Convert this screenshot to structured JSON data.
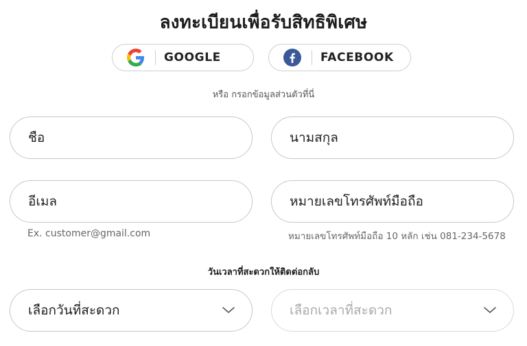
{
  "header": {
    "title": "ลงทะเบียนเพื่อรับสิทธิพิเศษ"
  },
  "social": {
    "google_label": "GOOGLE",
    "facebook_label": "FACEBOOK",
    "google_icon": "google-icon",
    "facebook_icon": "facebook-icon",
    "facebook_color": "#3b5998"
  },
  "divider_text": "หรือ กรอกข้อมูลส่วนตัวที่นี่",
  "form": {
    "first_name": {
      "placeholder": "ชื่อ",
      "value": ""
    },
    "last_name": {
      "placeholder": "นามสกุล",
      "value": ""
    },
    "email": {
      "placeholder": "อีเมล",
      "value": "",
      "hint": "Ex. customer@gmail.com"
    },
    "phone": {
      "placeholder": "หมายเลขโทรศัพท์มือถือ",
      "value": "",
      "hint": "หมายเลขโทรศัพท์มือถือ 10 หลัก เช่น 081-234-5678"
    }
  },
  "contact": {
    "label": "วันเวลาที่สะดวกให้ติดต่อกลับ",
    "date_select": {
      "value": "เลือกวันที่สะดวก",
      "icon": "chevron-down-icon"
    },
    "time_select": {
      "value": "เลือกเวลาที่สะดวก",
      "icon": "chevron-down-icon"
    }
  }
}
